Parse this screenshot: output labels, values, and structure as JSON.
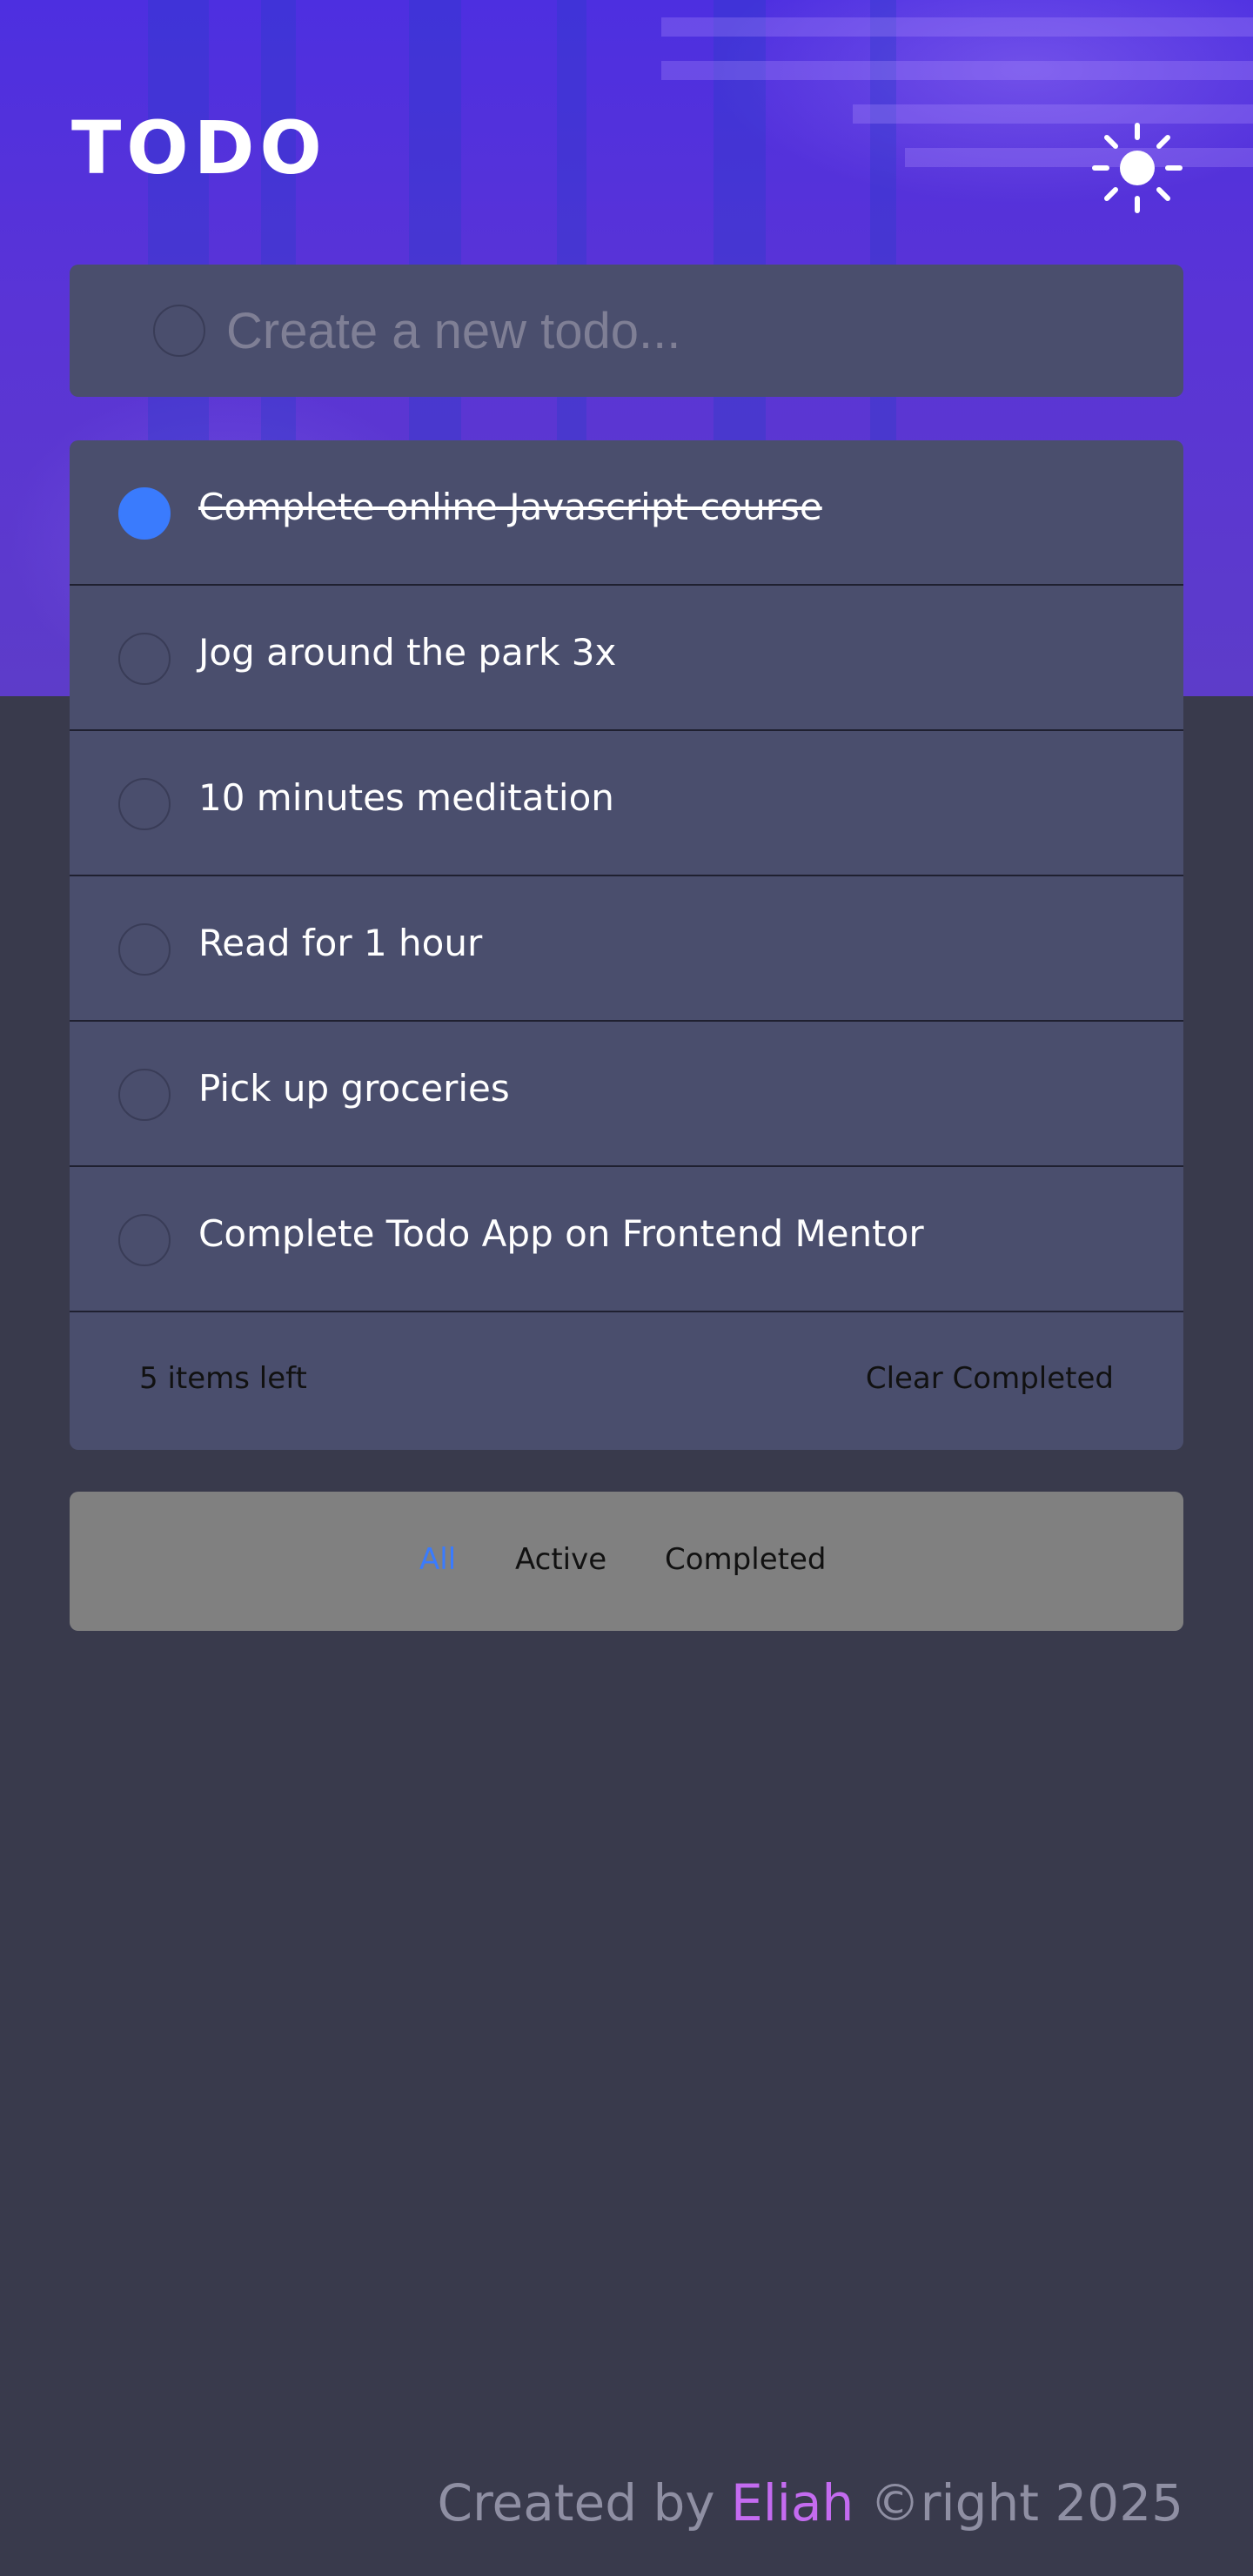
{
  "header": {
    "title": "TODO",
    "theme_icon": "sun-icon"
  },
  "new_todo": {
    "placeholder": "Create a new todo..."
  },
  "todos": [
    {
      "text": "Complete online Javascript course",
      "completed": true
    },
    {
      "text": "Jog around the park 3x",
      "completed": false
    },
    {
      "text": "10 minutes meditation",
      "completed": false
    },
    {
      "text": "Read for 1 hour",
      "completed": false
    },
    {
      "text": "Pick up groceries",
      "completed": false
    },
    {
      "text": "Complete Todo App on Frontend Mentor",
      "completed": false
    }
  ],
  "footer": {
    "items_left": "5 items left",
    "clear_label": "Clear Completed"
  },
  "filters": {
    "all": "All",
    "active": "Active",
    "completed": "Completed",
    "selected": "All"
  },
  "credit": {
    "prefix": "Created by ",
    "author": "Eliah",
    "suffix": " ©right 2025"
  },
  "colors": {
    "accent": "#3a7bfd",
    "author": "#c46bf0",
    "card": "#4a4e6d",
    "background": "#393a4c"
  }
}
